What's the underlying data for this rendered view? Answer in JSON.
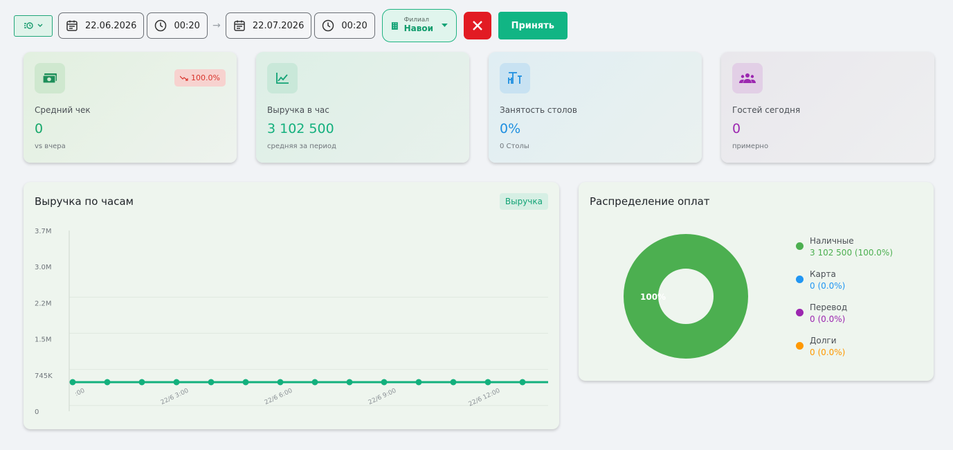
{
  "toolbar": {
    "mode_icon": "history-icon",
    "date_from": "22.06.2026",
    "time_from": "00:20",
    "date_to": "22.07.2026",
    "time_to": "00:20",
    "branch_label": "Филиал",
    "branch_value": "Навои",
    "accept_label": "Принять"
  },
  "kpis": [
    {
      "icon": "money-icon",
      "title": "Средний чек",
      "value": "0",
      "sub": "vs вчера",
      "badge": "100.0%",
      "color": "#17a86b",
      "badge_color": "#d9342b"
    },
    {
      "icon": "line-chart-icon",
      "title": "Выручка в час",
      "value": "3 102 500",
      "sub": "средняя за период",
      "color": "#13b07d"
    },
    {
      "icon": "table-icon",
      "title": "Занятость столов",
      "value": "0%",
      "sub": "0 Столы",
      "color": "#1e8fe0"
    },
    {
      "icon": "group-icon",
      "title": "Гостей сегодня",
      "value": "0",
      "sub": "примерно",
      "color": "#9c27b0"
    }
  ],
  "revenue_panel": {
    "title": "Выручка по часам",
    "tag": "Выручка"
  },
  "payments_panel": {
    "title": "Распределение оплат"
  },
  "chart_data": [
    {
      "type": "line",
      "title": "Выручка по часам",
      "y_ticks": [
        "3.7M",
        "3.0M",
        "2.2M",
        "1.5M",
        "745K",
        "0"
      ],
      "ylim": [
        0,
        3722500
      ],
      "x_tick_labels": [
        ":00",
        "22/6 3:00",
        "22/6 6:00",
        "22/6 9:00",
        "22/6 12:00"
      ],
      "series": [
        {
          "name": "Выручка",
          "color": "#13b07d",
          "values": [
            0,
            0,
            0,
            0,
            0,
            0,
            0,
            0,
            0,
            0,
            0,
            0,
            0,
            0
          ]
        }
      ],
      "grid": true
    },
    {
      "type": "pie",
      "title": "Распределение оплат",
      "center_label": "100%",
      "slices": [
        {
          "name": "Наличные",
          "value": 3102500,
          "display": "3 102 500 (100.0%)",
          "color": "#4caf50"
        },
        {
          "name": "Карта",
          "value": 0,
          "display": "0 (0.0%)",
          "color": "#2196f3"
        },
        {
          "name": "Перевод",
          "value": 0,
          "display": "0 (0.0%)",
          "color": "#9c27b0"
        },
        {
          "name": "Долги",
          "value": 0,
          "display": "0 (0.0%)",
          "color": "#ff9800"
        }
      ]
    }
  ]
}
